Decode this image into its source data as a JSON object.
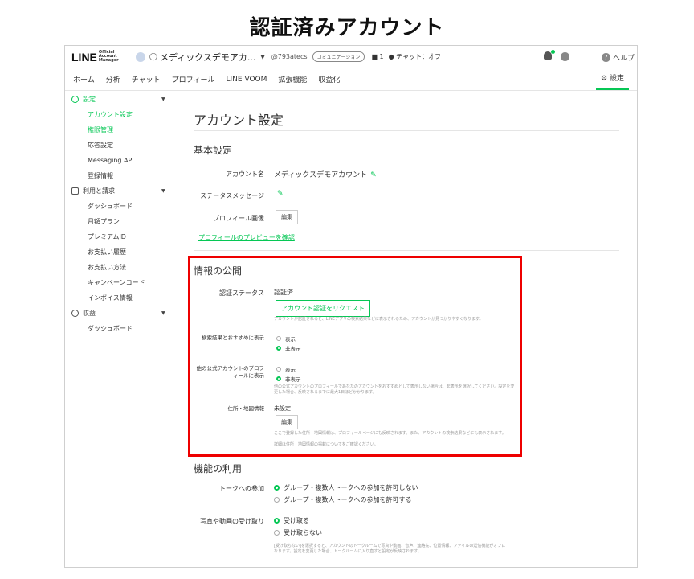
{
  "page_title": "認証済みアカウント",
  "topbar": {
    "logo": "LINE",
    "logo_sub": "Official Account Manager",
    "account_name": "メディックスデモアカ...",
    "account_id": "@793atecs",
    "plan_badge": "コミュニケーション",
    "people_count": "1",
    "chat_status": "チャット：オフ",
    "help": "ヘルプ"
  },
  "nav": {
    "items": [
      "ホーム",
      "分析",
      "チャット",
      "プロフィール",
      "LINE VOOM",
      "拡張機能",
      "収益化"
    ],
    "settings": "設定"
  },
  "sidebar": {
    "settings_section": "設定",
    "settings_items": [
      "アカウント設定",
      "権限管理",
      "応答設定",
      "Messaging API",
      "登録情報"
    ],
    "billing_section": "利用と請求",
    "billing_items": [
      "ダッシュボード",
      "月額プラン",
      "プレミアムID",
      "お支払い履歴",
      "お支払い方法",
      "キャンペーンコード",
      "インボイス情報"
    ],
    "revenue_section": "収益",
    "revenue_items": [
      "ダッシュボード"
    ]
  },
  "main": {
    "title": "アカウント設定",
    "basic": {
      "heading": "基本設定",
      "account_name_label": "アカウント名",
      "account_name_value": "メディックスデモアカウント",
      "status_label": "ステータスメッセージ",
      "profile_image_label": "プロフィール画像",
      "edit_button": "編集",
      "preview_link": "プロフィールのプレビューを確認"
    },
    "publish": {
      "heading": "情報の公開",
      "auth_status_label": "認証ステータス",
      "auth_status_value": "認証済",
      "request_button": "アカウント認証をリクエスト",
      "request_note": "アカウントが認証されると、LINEアプリの検索結果などに表示されるため、アカウントが見つかりやすくなります。",
      "search_label": "検索結果とおすすめに表示",
      "show": "表示",
      "hide": "非表示",
      "other_label": "他の公式アカウントのプロフィールに表示",
      "other_note": "他の公式アカウントのプロフィールであなたのアカウントをおすすめとして表示しない場合は、非表示を選択してください。設定を変更した場合、反映されるまでに最大1日ほどかかります。",
      "address_label": "住所・地図情報",
      "address_value": "未設定",
      "address_edit": "編集",
      "address_note1": "ここで登録した住所・地図情報は、プロフィールページにも反映されます。また、アカウントの検索結果などにも表示されます。",
      "address_note2": "詳細は住所・地図情報の掲載についてをご確認ください。"
    },
    "features": {
      "heading": "機能の利用",
      "talk_label": "トークへの参加",
      "talk_allow": "グループ・複数人トークへの参加を許可しない",
      "talk_deny": "グループ・複数人トークへの参加を許可する",
      "media_label": "写真や動画の受け取り",
      "media_accept": "受け取る",
      "media_reject": "受け取らない",
      "media_note": "[受け取らない]を選択すると、アカウントのトークルームで写真や動画、音声、連絡先、位置情報、ファイルの送信機能がオフになります。設定を変更した場合、トークルームに入り直すと設定が反映されます。"
    }
  },
  "colors": {
    "accent": "#06c755",
    "highlight": "#e00000"
  }
}
